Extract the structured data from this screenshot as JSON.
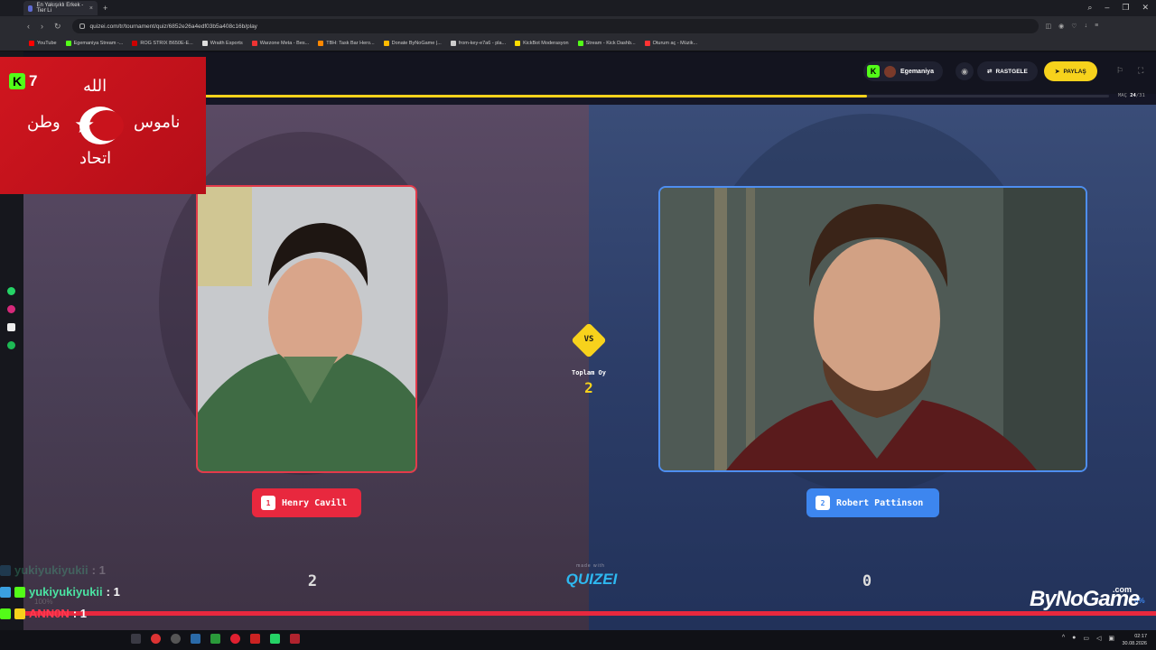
{
  "browser": {
    "tab_title": "En Yakışıklı Erkek - Tier Li",
    "url": "quizei.com/tr/tournament/quiz/6852e26a4edf03b5a408c16b/play",
    "bookmarks": [
      "YouTube",
      "Egemaniya Stream -...",
      "ROG STRIX B650E-E...",
      "Wraith Esports",
      "Warzone Meta - Bes...",
      "TBH: Task Bar Hero...",
      "Donate ByNoGame |...",
      "from-key-e7a6 - pla...",
      "KickBot Moderasyon",
      "Stream - Kick Dashb...",
      "Oturum aç - Müzik..."
    ]
  },
  "header": {
    "username": "Egemaniya",
    "random_label": "RASTGELE",
    "share_label": "PAYLAŞ",
    "match_prefix": "MAÇ",
    "match_current": "24",
    "match_total": "/31",
    "progress": 0.733
  },
  "contest": {
    "left": {
      "number": "1",
      "name": "Henry Cavill",
      "score": "2"
    },
    "right": {
      "number": "2",
      "name": "Robert Pattinson",
      "score": "0"
    },
    "vs_label": "VS",
    "total_label": "Toplam Oy",
    "total_value": "2",
    "made_with": "made with",
    "brand": "QUIZEI",
    "right_percent": "0%"
  },
  "overlay": {
    "kick_viewers": "7",
    "chat": [
      {
        "user": "yukiyukiyukii",
        "msg": ": 1"
      },
      {
        "user": "yukiyukiyukii",
        "msg": ": 1"
      },
      {
        "user": "ANN0N",
        "msg": ": 1"
      },
      {
        "user": "yukiyukiyukii",
        "msg": ": 1"
      }
    ],
    "chat_faint": "100%",
    "watermark": "ByNoGame",
    "watermark_suffix": ".com"
  },
  "taskbar": {
    "time": "02:17",
    "date": "30.08.2026"
  },
  "colors": {
    "accent_yellow": "#f7d21c",
    "left_red": "#e8283e",
    "right_blue": "#3d86ef",
    "kick_green": "#53fc18"
  }
}
